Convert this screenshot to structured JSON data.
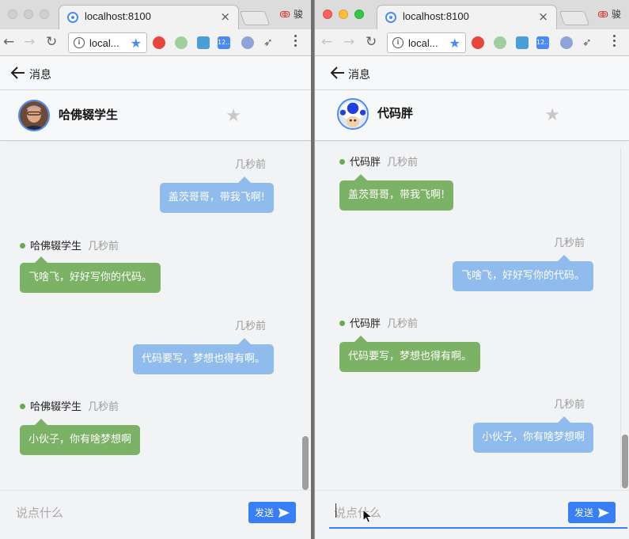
{
  "browser": {
    "tab_title": "localhost:8100",
    "tab_close": "×",
    "url": "local...",
    "profile_name": "骏",
    "ext_badge": "12..."
  },
  "colors": {
    "accent": "#387ef5",
    "bubble_green": "#7cb265",
    "bubble_blue": "#8fbcec",
    "online_dot": "#6aaa52"
  },
  "left_window": {
    "header": {
      "back_label": "消息"
    },
    "chat": {
      "name": "哈佛辍学生",
      "avatar": "person-photo-avatar"
    },
    "messages": [
      {
        "side": "right",
        "sender": "",
        "time": "几秒前",
        "text": "盖茨哥哥，带我飞啊!"
      },
      {
        "side": "left",
        "sender": "哈佛辍学生",
        "time": "几秒前",
        "text": "飞啥飞，好好写你的代码。"
      },
      {
        "side": "right",
        "sender": "",
        "time": "几秒前",
        "text": "代码要写，梦想也得有啊。"
      },
      {
        "side": "left",
        "sender": "哈佛辍学生",
        "time": "几秒前",
        "text": "小伙子，你有啥梦想啊"
      }
    ],
    "input": {
      "placeholder": "说点什么",
      "value": ""
    },
    "send_label": "发送"
  },
  "right_window": {
    "header": {
      "back_label": "消息"
    },
    "chat": {
      "name": "代码胖",
      "avatar": "mushroom-toad-avatar"
    },
    "messages": [
      {
        "side": "left",
        "sender": "代码胖",
        "time": "几秒前",
        "text": "盖茨哥哥，带我飞啊!"
      },
      {
        "side": "right",
        "sender": "",
        "time": "几秒前",
        "text": "飞啥飞，好好写你的代码。"
      },
      {
        "side": "left",
        "sender": "代码胖",
        "time": "几秒前",
        "text": "代码要写，梦想也得有啊。"
      },
      {
        "side": "right",
        "sender": "",
        "time": "几秒前",
        "text": "小伙子，你有啥梦想啊"
      }
    ],
    "input": {
      "placeholder": "说点什么",
      "value": ""
    },
    "send_label": "发送"
  }
}
